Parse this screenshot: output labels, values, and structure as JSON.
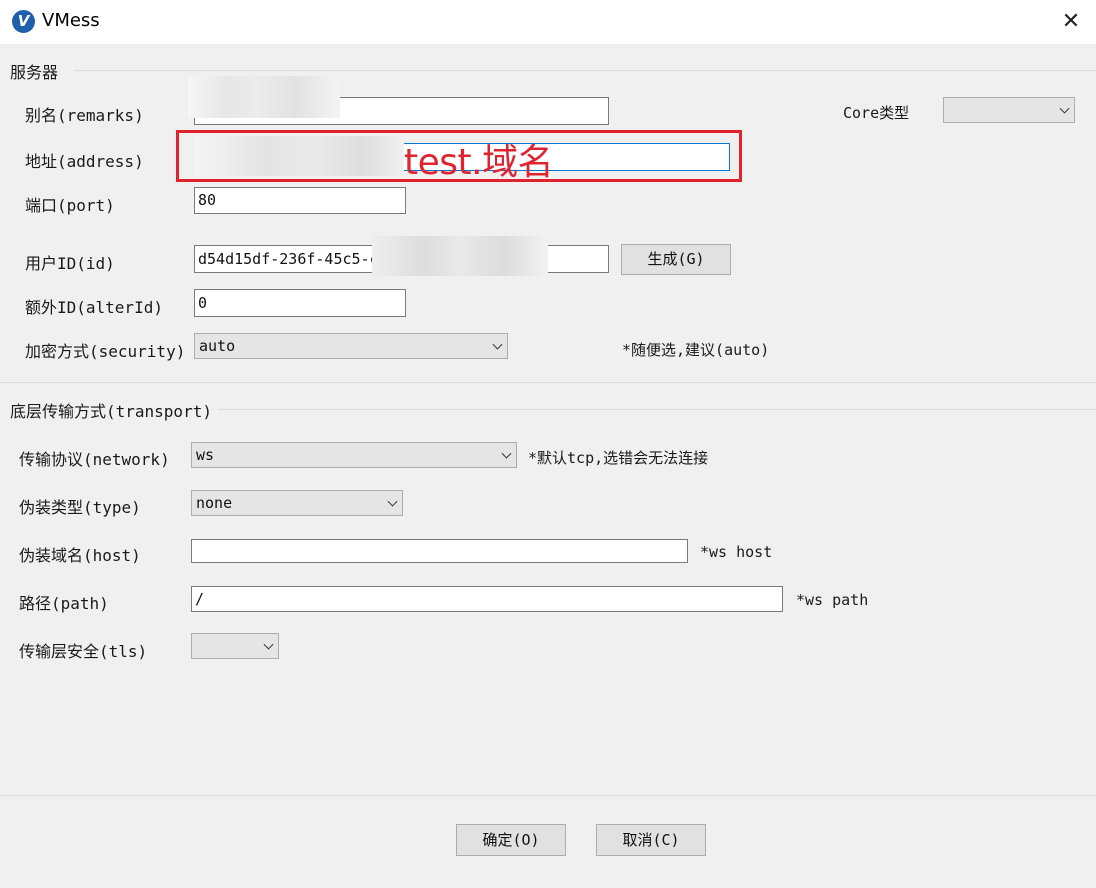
{
  "window": {
    "title": "VMess",
    "close_glyph": "✕",
    "app_icon": "v2rayN-logo-icon",
    "app_icon_glyph": "V"
  },
  "server_group": {
    "title": "服务器",
    "remarks_label": "别名(remarks)",
    "remarks_value": "",
    "address_label": "地址(address)",
    "address_value": "",
    "port_label": "端口(port)",
    "port_value": "80",
    "id_label": "用户ID(id)",
    "id_value": "d54d15df-236f-45c5-c",
    "generate_button": "生成(G)",
    "alter_id_label": "额外ID(alterId)",
    "alter_id_value": "0",
    "security_label": "加密方式(security)",
    "security_value": "auto",
    "security_hint": "*随便选,建议(auto)",
    "core_type_label": "Core类型",
    "core_type_value": ""
  },
  "transport_group": {
    "title": "底层传输方式(transport)",
    "network_label": "传输协议(network)",
    "network_value": "ws",
    "network_hint": "*默认tcp,选错会无法连接",
    "type_label": "伪装类型(type)",
    "type_value": "none",
    "host_label": "伪装域名(host)",
    "host_value": "",
    "host_hint": "*ws host",
    "path_label": "路径(path)",
    "path_value": "/",
    "path_hint": "*ws path",
    "tls_label": "传输层安全(tls)",
    "tls_value": ""
  },
  "annotation": {
    "text": "test.域名",
    "color": "#e0232e"
  },
  "footer": {
    "ok_button": "确定(O)",
    "cancel_button": "取消(C)"
  },
  "colors": {
    "focus_border": "#0078d7",
    "window_bg": "#f0f0f0"
  }
}
